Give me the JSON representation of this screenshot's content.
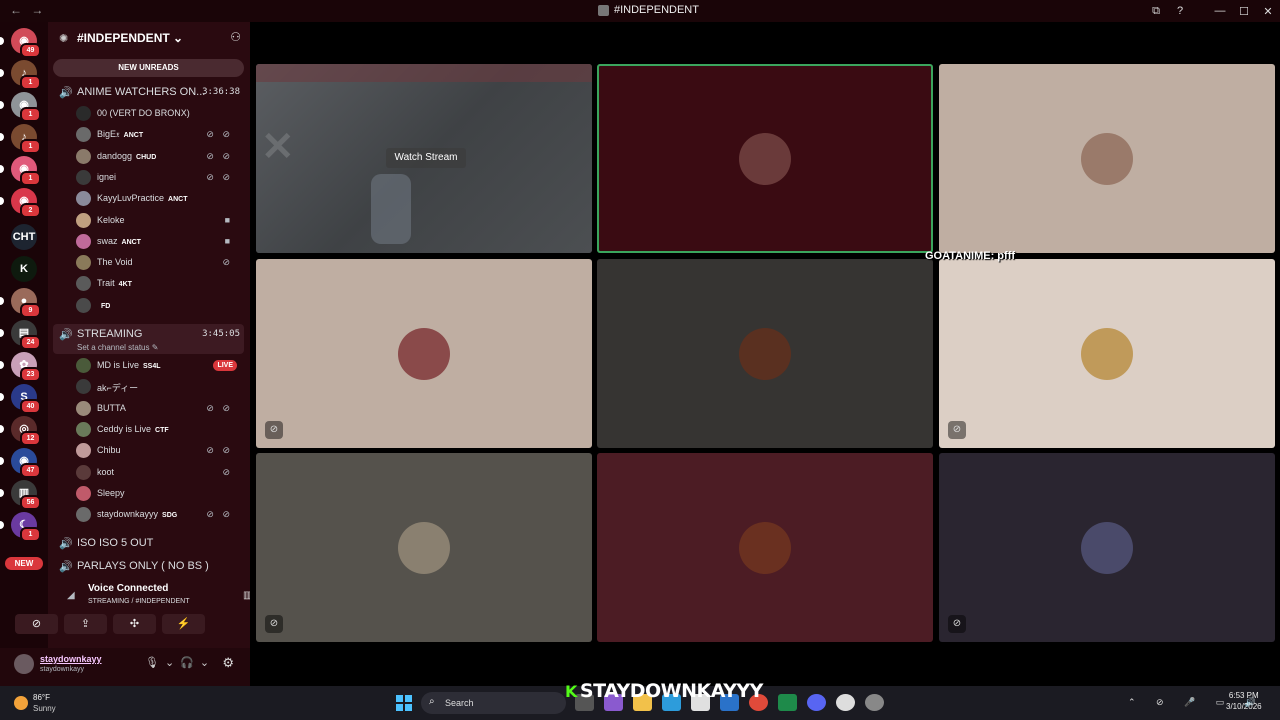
{
  "window": {
    "title": "#INDEPENDENT",
    "nav_back": "←",
    "nav_forward": "→",
    "controls": [
      "⧉",
      "?",
      "—",
      "☐",
      "✕"
    ]
  },
  "rail": {
    "servers": [
      {
        "badge": "49",
        "color": "#d14a58",
        "glyph": "◉"
      },
      {
        "badge": "1",
        "color": "#7a4a30",
        "glyph": "♪"
      },
      {
        "badge": "1",
        "color": "#8f9498",
        "glyph": "◉"
      },
      {
        "badge": "1",
        "color": "#7a4a30",
        "glyph": "♪"
      },
      {
        "badge": "1",
        "color": "#e0597a",
        "glyph": "◉"
      },
      {
        "badge": "2",
        "color": "#d9374a",
        "glyph": "◉"
      },
      {
        "badge": "",
        "color": "#1d2430",
        "glyph": "CHT"
      },
      {
        "badge": "",
        "color": "#0e1a0e",
        "glyph": "K"
      },
      {
        "badge": "9",
        "color": "#9a6a5a",
        "glyph": "●"
      },
      {
        "badge": "24",
        "color": "#3a3a3a",
        "glyph": "▤"
      },
      {
        "badge": "23",
        "color": "#c9a0b8",
        "glyph": "✿"
      },
      {
        "badge": "40",
        "color": "#2a3a8a",
        "glyph": "S"
      },
      {
        "badge": "12",
        "color": "#5a2a2a",
        "glyph": "◎"
      },
      {
        "badge": "47",
        "color": "#2a4a9a",
        "glyph": "◉"
      },
      {
        "badge": "56",
        "color": "#3a3a3a",
        "glyph": "▥"
      },
      {
        "badge": "1",
        "color": "#6a3aa0",
        "glyph": "☾"
      }
    ],
    "new_label": "NEW"
  },
  "guild": {
    "name": "#INDEPENDENT",
    "chevron": "⌄",
    "new_unreads": "NEW UNREADS"
  },
  "channels": [
    {
      "name": "ANIME WATCHERS ON...",
      "timer": "3:36:38",
      "members": [
        {
          "name": "00 (VERT DO BRONX)",
          "tag": "",
          "icons": "",
          "color": "#2a2a2a"
        },
        {
          "name": "BigE𝔵",
          "tag": "ANCT",
          "icons": "⊘ ⊘",
          "color": "#6a6a6a"
        },
        {
          "name": "dandogg",
          "tag": "CHUD",
          "icons": "⊘ ⊘",
          "color": "#8a7a6a"
        },
        {
          "name": "ignei",
          "tag": "",
          "icons": "⊘ ⊘",
          "color": "#3a3a3a"
        },
        {
          "name": "KayyLuvPractice",
          "tag": "ANCT",
          "icons": "",
          "color": "#8a8a9a"
        },
        {
          "name": "Keloke",
          "tag": "",
          "icons": "■",
          "color": "#c0a080"
        },
        {
          "name": "swaz",
          "tag": "ANCT",
          "icons": "■",
          "color": "#c06a9a"
        },
        {
          "name": "The Void",
          "tag": "",
          "icons": "⊘",
          "color": "#8a7a5a"
        },
        {
          "name": "Trait",
          "tag": "4KT",
          "icons": "",
          "color": "#5a5a5a"
        },
        {
          "name": "",
          "tag": "FD",
          "icons": "",
          "color": "#4a4a4a"
        }
      ]
    },
    {
      "name": "STREAMING",
      "timer": "3:45:05",
      "status": "Set a channel status ✎",
      "members": [
        {
          "name": "MD is Live",
          "tag": "SS4L",
          "icons": "",
          "live": "LIVE",
          "color": "#4a5a3a"
        },
        {
          "name": "ak⌐ディー",
          "tag": "",
          "icons": "",
          "color": "#3a3a3a"
        },
        {
          "name": "BUTTA",
          "tag": "",
          "icons": "⊘ ⊘",
          "color": "#9a8a7a"
        },
        {
          "name": "Ceddy is Live",
          "tag": "CTF",
          "icons": "",
          "color": "#6a7a5a"
        },
        {
          "name": "Chibu",
          "tag": "",
          "icons": "⊘ ⊘",
          "color": "#c09a9a"
        },
        {
          "name": "koot",
          "tag": "",
          "icons": "⊘",
          "color": "#5a3a3a"
        },
        {
          "name": "Sleepy",
          "tag": "",
          "icons": "",
          "color": "#c05a6a"
        },
        {
          "name": "staydownkayyy",
          "tag": "SDG",
          "icons": "⊘ ⊘",
          "color": "#6a6a6a"
        }
      ]
    },
    {
      "name": "ISO ISO 5 OUT",
      "timer": "",
      "members": []
    },
    {
      "name": "PARLAYS ONLY ( NO BS )",
      "timer": "",
      "members": []
    }
  ],
  "voice": {
    "title": "Voice Connected",
    "subtitle": "STREAMING / #INDEPENDENT",
    "buttons": [
      "⊘",
      "⇪",
      "✣",
      "⚡"
    ]
  },
  "user": {
    "display_name": "staydownkayy",
    "handle": "staydownkayy"
  },
  "grid": {
    "watch_stream": "Watch Stream",
    "overlay_text": "GOATANIME: pfff",
    "tiles": [
      {
        "bg": "#3e4144",
        "avatar": "",
        "mute": "",
        "stream": true
      },
      {
        "bg": "#3a0b12",
        "avatar": "#6a3a3a",
        "mute": "",
        "border": "#3ba55d"
      },
      {
        "bg": "#bfaea2",
        "avatar": "#9a7a6a",
        "mute": ""
      },
      {
        "bg": "#bfaea2",
        "avatar": "#8a4a4a",
        "mute": "⊘"
      },
      {
        "bg": "#363432",
        "avatar": "#5a3020",
        "mute": ""
      },
      {
        "bg": "#dccfc5",
        "avatar": "#c09a5a",
        "mute": "⊘"
      },
      {
        "bg": "#55524c",
        "avatar": "#8a8070",
        "mute": "⊘"
      },
      {
        "bg": "#4c1c24",
        "avatar": "#6a3020",
        "mute": ""
      },
      {
        "bg": "#2a2530",
        "avatar": "#4a4a6a",
        "mute": "⊘"
      }
    ]
  },
  "taskbar": {
    "weather_temp": "86°F",
    "weather_cond": "Sunny",
    "search": "Search",
    "time": "6:53 PM",
    "date": "3/10/2026",
    "streamer": "STAYDOWNKAYYY",
    "streamer_logo": "K"
  }
}
